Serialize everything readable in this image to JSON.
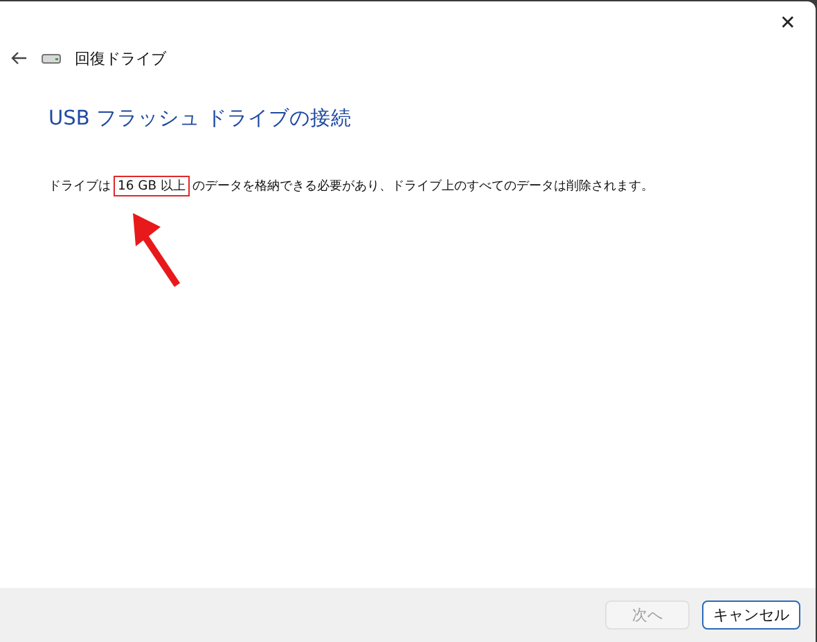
{
  "window": {
    "close_glyph": "✕"
  },
  "header": {
    "title": "回復ドライブ"
  },
  "heading": "USB フラッシュ ドライブの接続",
  "description": {
    "before": "ドライブは",
    "highlight": "16 GB 以上",
    "after": "のデータを格納できる必要があり、ドライブ上のすべてのデータは削除されます。"
  },
  "buttons": [
    {
      "label": "次へ",
      "disabled": true
    },
    {
      "label": "キャンセル",
      "disabled": false
    }
  ]
}
